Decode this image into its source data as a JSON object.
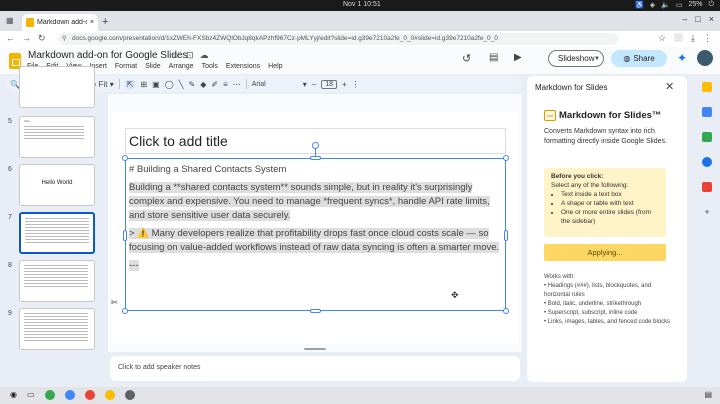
{
  "os": {
    "clock": "Nov 1  10:51",
    "battery": "25%",
    "status_icons": [
      "accessibility-icon",
      "network-icon",
      "volume-icon",
      "battery-icon",
      "power-icon"
    ]
  },
  "browser": {
    "tab_title": "Markdown add-on for G",
    "new_tab": "+",
    "url": "docs.google.com/presentation/d/1xZWEh-FXSbz4ZWQlObJq8qkAPzhf967Cz-pMLYyj/edit?slide=id.g39e7210a2fe_0_0#slide=id.g39e7210a2fe_0_0"
  },
  "app": {
    "doc_title": "Markdown add-on for Google Slides",
    "menus": [
      "File",
      "Edit",
      "View",
      "Insert",
      "Format",
      "Slide",
      "Arrange",
      "Tools",
      "Extensions",
      "Help"
    ],
    "slideshow_label": "Slideshow",
    "share_label": "Share",
    "brand_color": "#f4b400",
    "share_color": "#c2e7ff"
  },
  "toolbar": {
    "zoom": "Fit",
    "font": "Arial",
    "font_size": "18"
  },
  "thumbnails": [
    {
      "num": "5",
      "heading": "Color",
      "selected": false
    },
    {
      "num": "6",
      "text": "Hello World",
      "selected": false
    },
    {
      "num": "7",
      "selected": true
    },
    {
      "num": "8",
      "selected": false
    },
    {
      "num": "9",
      "selected": false
    }
  ],
  "slide": {
    "title_placeholder": "Click to add title",
    "heading": "# Building a Shared Contacts System",
    "para1": "Building a **shared contacts system** sounds simple, but in reality it's surprisingly complex and expensive. You need to manage *frequent syncs*, handle API rate limits, and store sensitive user data securely.",
    "para2": "> ⚠️ Many developers realize that profitability drops fast once cloud costs scale — so focusing on value-added workflows instead of raw data syncing is often a smarter move.",
    "para3": "---"
  },
  "notes": {
    "placeholder": "Click to add speaker notes"
  },
  "panel": {
    "header": "Markdown for Slides",
    "title": "Markdown for Slides™",
    "logo": "md",
    "description": "Converts Markdown syntax into rich formatting directly inside Google Slides.",
    "before_title": "Before you click:",
    "before_intro": "Select any of the following:",
    "before_items": [
      "Text inside a text box",
      "A shape or table with text",
      "One or more entire slides (from the sidebar)"
    ],
    "apply_label": "Applying...",
    "works_title": "Works with:",
    "works_items": [
      "• Headings (###), lists, blockquotes, and horizontal rules",
      "• Bold, italic, underline, strikethrough",
      "• Superscript, subscript, inline code",
      "• Links, images, tables, and fenced code blocks"
    ],
    "apply_color": "#fdd663"
  }
}
